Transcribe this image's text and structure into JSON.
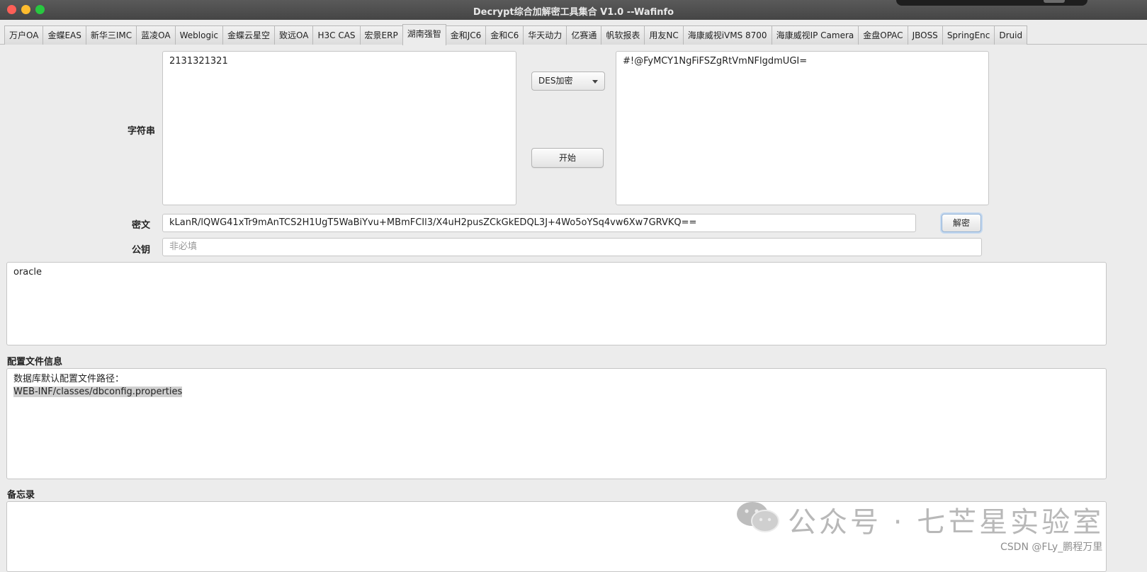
{
  "window": {
    "title": "Decrypt综合加解密工具集合 V1.0  --Wafinfo"
  },
  "tabs": [
    "万户OA",
    "金蝶EAS",
    "新华三IMC",
    "蓝凌OA",
    "Weblogic",
    "金蝶云星空",
    "致远OA",
    "H3C CAS",
    "宏景ERP",
    "湖南强智",
    "金和JC6",
    "金和C6",
    "华天动力",
    "亿赛通",
    "帆软报表",
    "用友NC",
    "海康威视iVMS 8700",
    "海康威视IP Camera",
    "金盘OPAC",
    "JBOSS",
    "SpringEnc",
    "Druid"
  ],
  "active_tab_index": 9,
  "encrypt": {
    "label": "字符串",
    "input_value": "2131321321",
    "mode_select": "DES加密",
    "start_button": "开始",
    "output_value": "#!@FyMCY1NgFiFSZgRtVmNFlgdmUGI="
  },
  "decrypt": {
    "cipher_label": "密文",
    "cipher_value": "kLanR/lQWG41xTr9mAnTCS2H1UgT5WaBiYvu+MBmFCIl3/X4uH2pusZCkGkEDQL3J+4Wo5oYSq4vw6Xw7GRVKQ==",
    "decrypt_button": "解密",
    "pubkey_label": "公钥",
    "pubkey_placeholder": "非必填",
    "result_value": "oracle"
  },
  "config": {
    "label": "配置文件信息",
    "line1": "数据库默认配置文件路径：",
    "line2": "WEB-INF/classes/dbconfig.properties"
  },
  "memo": {
    "label": "备忘录",
    "value": ""
  },
  "watermark": {
    "icon": "wechat-icon",
    "text": "公众号 · 七芒星实验室",
    "csdn": "CSDN @FLy_鹏程万里"
  },
  "colors": {
    "titlebar": "#4f4f4f",
    "background": "#ececec",
    "close": "#fe5f57",
    "minimize": "#febc2e",
    "zoom": "#28c840",
    "focus_ring": "#8fb0d6"
  }
}
